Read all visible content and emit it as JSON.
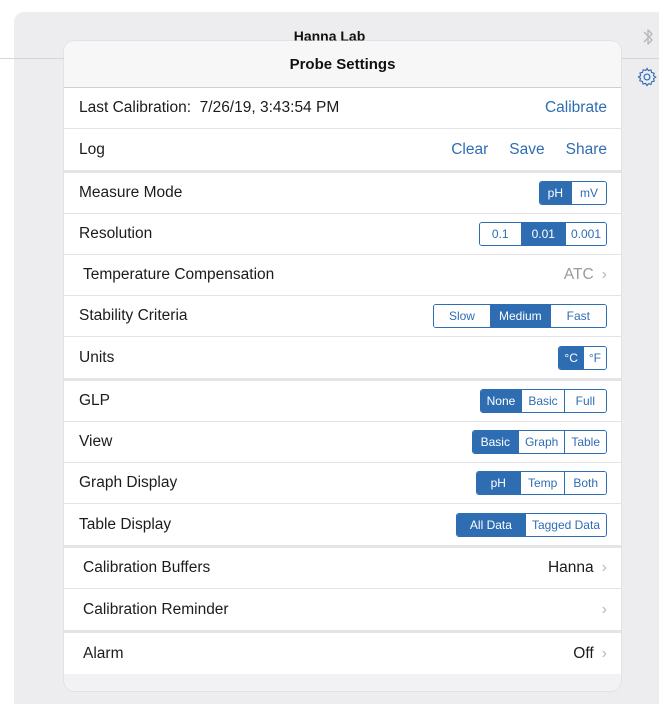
{
  "app": {
    "title": "Hanna Lab"
  },
  "modal": {
    "title": "Probe Settings",
    "last_calibration": {
      "label": "Last Calibration:",
      "value": "7/26/19, 3:43:54 PM",
      "action": "Calibrate"
    },
    "log": {
      "label": "Log",
      "actions": [
        "Clear",
        "Save",
        "Share"
      ]
    },
    "measure_mode": {
      "label": "Measure Mode",
      "options": [
        "pH",
        "mV"
      ],
      "selected": 0
    },
    "resolution": {
      "label": "Resolution",
      "options": [
        "0.1",
        "0.01",
        "0.001"
      ],
      "selected": 1
    },
    "temperature_compensation": {
      "label": "Temperature Compensation",
      "value": "ATC"
    },
    "stability_criteria": {
      "label": "Stability Criteria",
      "options": [
        "Slow",
        "Medium",
        "Fast"
      ],
      "selected": 1
    },
    "units": {
      "label": "Units",
      "options": [
        "°C",
        "°F"
      ],
      "selected": 0
    },
    "glp": {
      "label": "GLP",
      "options": [
        "None",
        "Basic",
        "Full"
      ],
      "selected": 0
    },
    "view": {
      "label": "View",
      "options": [
        "Basic",
        "Graph",
        "Table"
      ],
      "selected": 0
    },
    "graph_display": {
      "label": "Graph Display",
      "options": [
        "pH",
        "Temp",
        "Both"
      ],
      "selected": 0
    },
    "table_display": {
      "label": "Table Display",
      "options": [
        "All Data",
        "Tagged Data"
      ],
      "selected": 0
    },
    "calibration_buffers": {
      "label": "Calibration Buffers",
      "value": "Hanna"
    },
    "calibration_reminder": {
      "label": "Calibration Reminder",
      "value": ""
    },
    "alarm": {
      "label": "Alarm",
      "value": "Off"
    }
  },
  "colors": {
    "accent": "#2f6db3",
    "background": "#ededef",
    "chevron": "#b9b9be"
  },
  "icons": {
    "top_right": "bluetooth-icon",
    "settings": "gear-icon",
    "disclosure": "chevron-right-icon"
  }
}
